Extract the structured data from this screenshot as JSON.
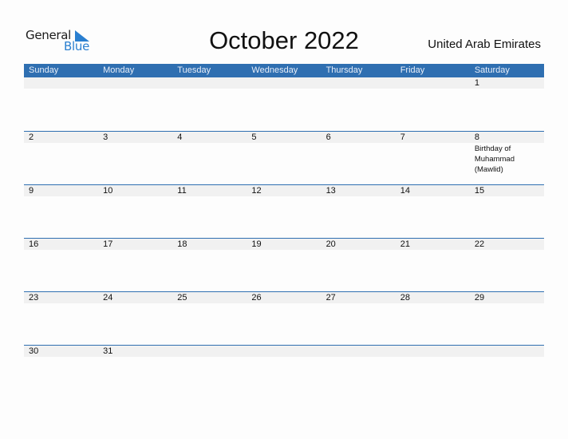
{
  "logo": {
    "word1": "General",
    "word2": "Blue"
  },
  "title": "October 2022",
  "country": "United Arab Emirates",
  "colors": {
    "header": "#2f6fb1",
    "band": "#f1f1f1",
    "logo_blue": "#2a7fd0"
  },
  "weekdays": [
    "Sunday",
    "Monday",
    "Tuesday",
    "Wednesday",
    "Thursday",
    "Friday",
    "Saturday"
  ],
  "weeks": [
    [
      {
        "day": ""
      },
      {
        "day": ""
      },
      {
        "day": ""
      },
      {
        "day": ""
      },
      {
        "day": ""
      },
      {
        "day": ""
      },
      {
        "day": "1"
      }
    ],
    [
      {
        "day": "2"
      },
      {
        "day": "3"
      },
      {
        "day": "4"
      },
      {
        "day": "5"
      },
      {
        "day": "6"
      },
      {
        "day": "7"
      },
      {
        "day": "8",
        "event": "Birthday of Muhammad (Mawlid)"
      }
    ],
    [
      {
        "day": "9"
      },
      {
        "day": "10"
      },
      {
        "day": "11"
      },
      {
        "day": "12"
      },
      {
        "day": "13"
      },
      {
        "day": "14"
      },
      {
        "day": "15"
      }
    ],
    [
      {
        "day": "16"
      },
      {
        "day": "17"
      },
      {
        "day": "18"
      },
      {
        "day": "19"
      },
      {
        "day": "20"
      },
      {
        "day": "21"
      },
      {
        "day": "22"
      }
    ],
    [
      {
        "day": "23"
      },
      {
        "day": "24"
      },
      {
        "day": "25"
      },
      {
        "day": "26"
      },
      {
        "day": "27"
      },
      {
        "day": "28"
      },
      {
        "day": "29"
      }
    ],
    [
      {
        "day": "30"
      },
      {
        "day": "31"
      },
      {
        "day": ""
      },
      {
        "day": ""
      },
      {
        "day": ""
      },
      {
        "day": ""
      },
      {
        "day": ""
      }
    ]
  ]
}
